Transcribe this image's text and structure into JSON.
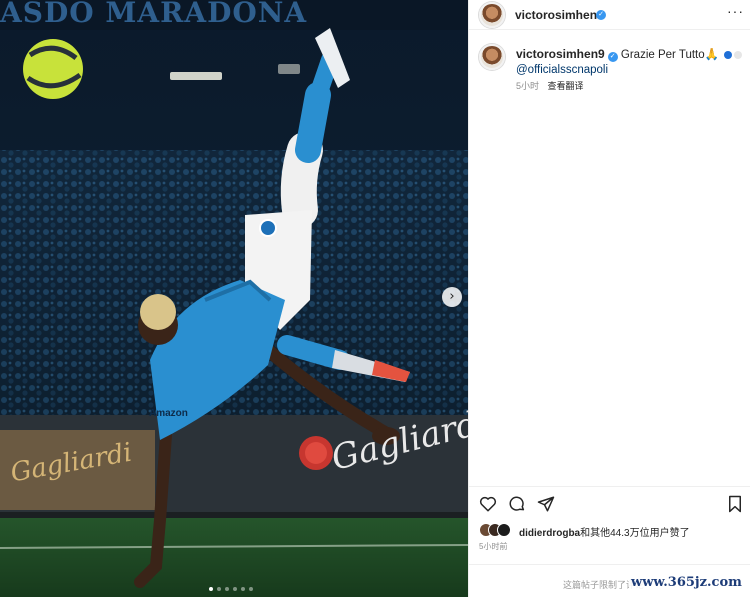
{
  "photo": {
    "banner_text": "ASDO MARADONA",
    "board_brand": "Gagliardi",
    "board_brand_left": "Gagliardi",
    "shirt_sponsor": "Amazon",
    "next_icon": "chevron-right-icon",
    "carousel_count": 6,
    "carousel_active_index": 0
  },
  "header": {
    "username": "victorosimhen9",
    "verified_icon": "verified-badge-icon",
    "more_icon": "more-options-icon",
    "more_glyph": "···"
  },
  "caption": {
    "username": "victorosimhen9",
    "text": "Grazie Per Tutto🙏",
    "emoji_colors": [
      "#1f6fd6",
      "#e6e6e6"
    ],
    "mention": "@officialsscnapoli",
    "time_ago": "5小时",
    "translate_label": "查看翻译"
  },
  "actions": {
    "like_icon": "heart-icon",
    "comment_icon": "comment-icon",
    "share_icon": "share-icon",
    "save_icon": "bookmark-icon"
  },
  "likes": {
    "liker": "didierdrogba",
    "rest": "和其他44.3万位用户赞了"
  },
  "post_time": "5小时前",
  "comment_bar": {
    "hint": "这篇帖子限制了评论",
    "watermark": "www.365jz.com"
  },
  "colors": {
    "accent": "#3897f0",
    "link": "#00376b",
    "napoli_blue": "#2a8fd0"
  }
}
